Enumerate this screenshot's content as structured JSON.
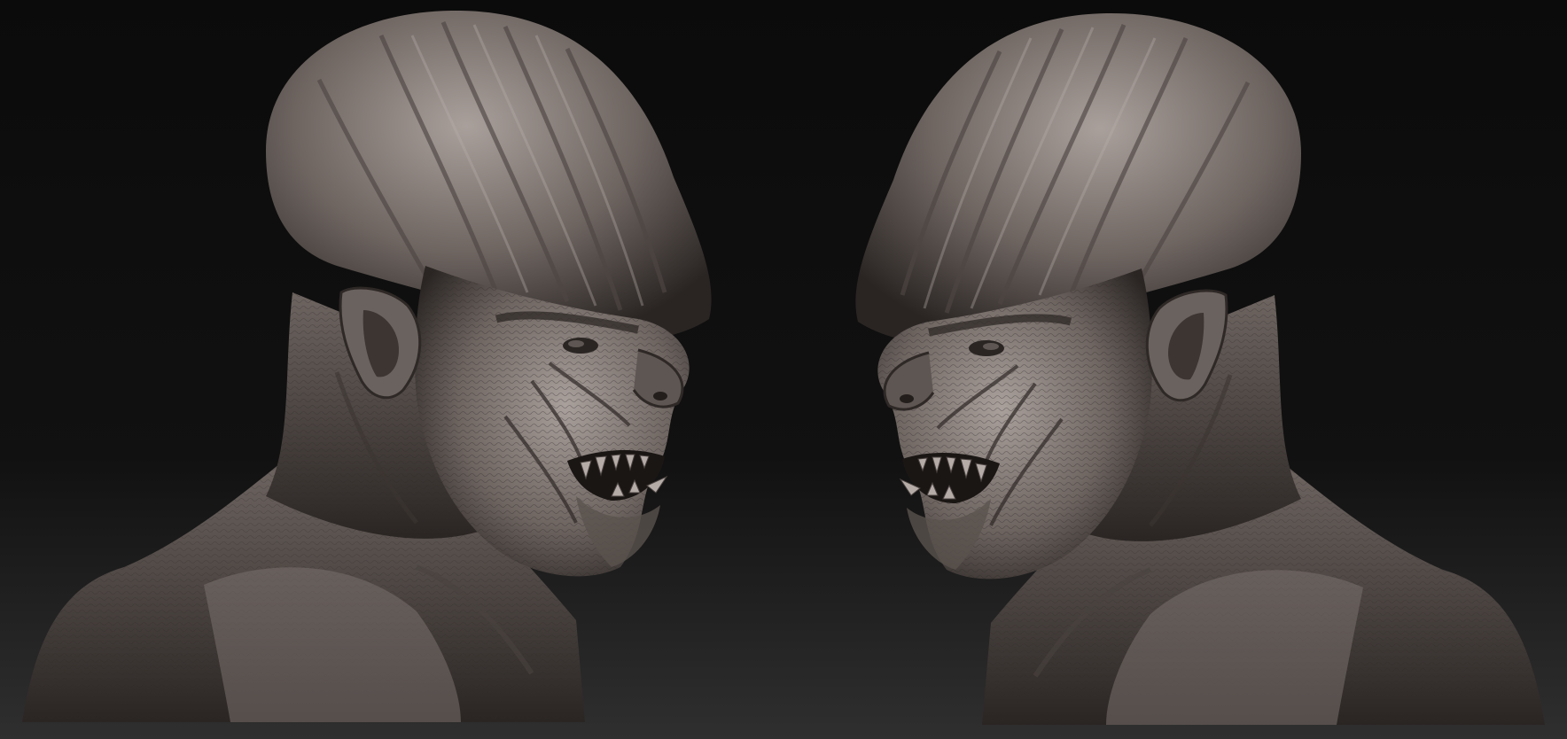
{
  "scene": {
    "background_top": "#0b0b0b",
    "background_bottom": "#2f2f2f",
    "sculpt_base": "#6e6561",
    "sculpt_highlight": "#a9a09c",
    "sculpt_shadow": "#2a2523"
  },
  "busts": [
    {
      "facing": "right"
    },
    {
      "facing": "left"
    }
  ]
}
